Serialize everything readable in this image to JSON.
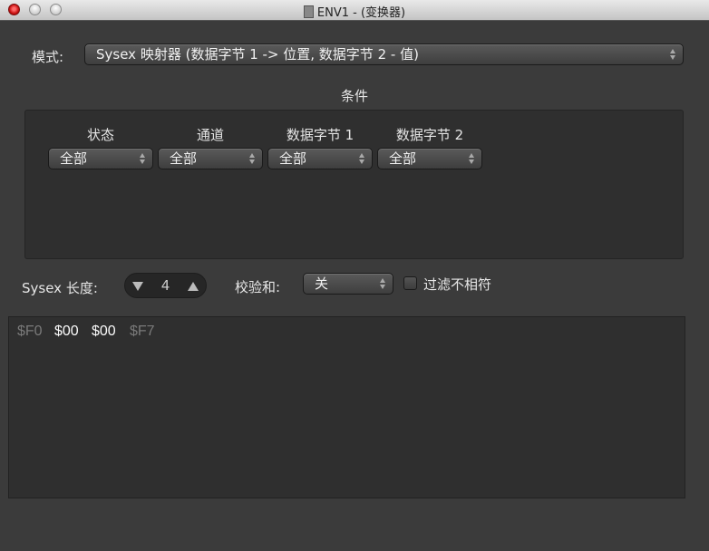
{
  "window": {
    "title": "ENV1 - (变换器)",
    "colors": {
      "background": "#3b3b3b",
      "panel": "#2f2f2f",
      "close": "#c81010"
    }
  },
  "mode": {
    "label": "模式:",
    "value": "Sysex 映射器 (数据字节 1 -> 位置, 数据字节 2 - 值)"
  },
  "conditions": {
    "title": "条件",
    "columns": [
      {
        "header": "状态",
        "value": "全部"
      },
      {
        "header": "通道",
        "value": "全部"
      },
      {
        "header": "数据字节 1",
        "value": "全部"
      },
      {
        "header": "数据字节 2",
        "value": "全部"
      }
    ]
  },
  "sysex": {
    "length_label": "Sysex 长度:",
    "length_value": "4",
    "checksum_label": "校验和:",
    "checksum_value": "关",
    "filter_label": "过滤不相符",
    "filter_checked": false
  },
  "bytes": [
    "$F0",
    "$00",
    "$00",
    "$F7"
  ]
}
